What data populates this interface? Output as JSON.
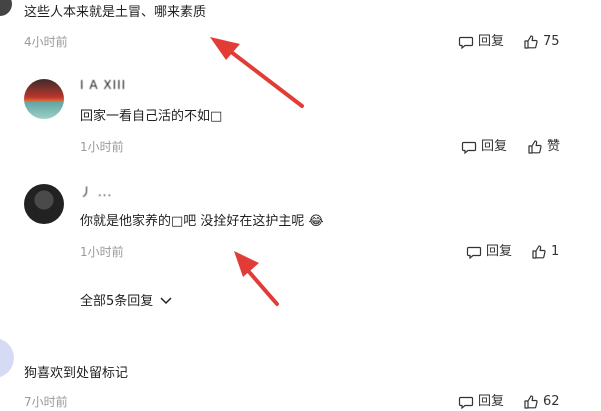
{
  "comments": [
    {
      "text": "这些人本来就是土冒、哪来素质",
      "time": "4小时前",
      "reply_label": "回复",
      "like_count": "75"
    },
    {
      "username": "I A XIII",
      "text": "回家一看自己活的不如□",
      "time": "1小时前",
      "reply_label": "回复",
      "like_label": "赞"
    },
    {
      "username": "丿 ...",
      "text": "你就是他家养的□吧 没拴好在这护主呢 😂",
      "time": "1小时前",
      "reply_label": "回复",
      "like_count": "1"
    },
    {
      "text": "狗喜欢到处留标记",
      "time": "7小时前",
      "reply_label": "回复",
      "like_count": "62"
    }
  ],
  "expand_replies_label": "全部5条回复",
  "colors": {
    "arrow": "#e23c36",
    "meta": "#9a9a9a",
    "avatar_blue": "#d6dbf5"
  },
  "icons": [
    "comment-icon",
    "thumbs-up-icon",
    "chevron-down-icon",
    "arrow-annotation"
  ]
}
